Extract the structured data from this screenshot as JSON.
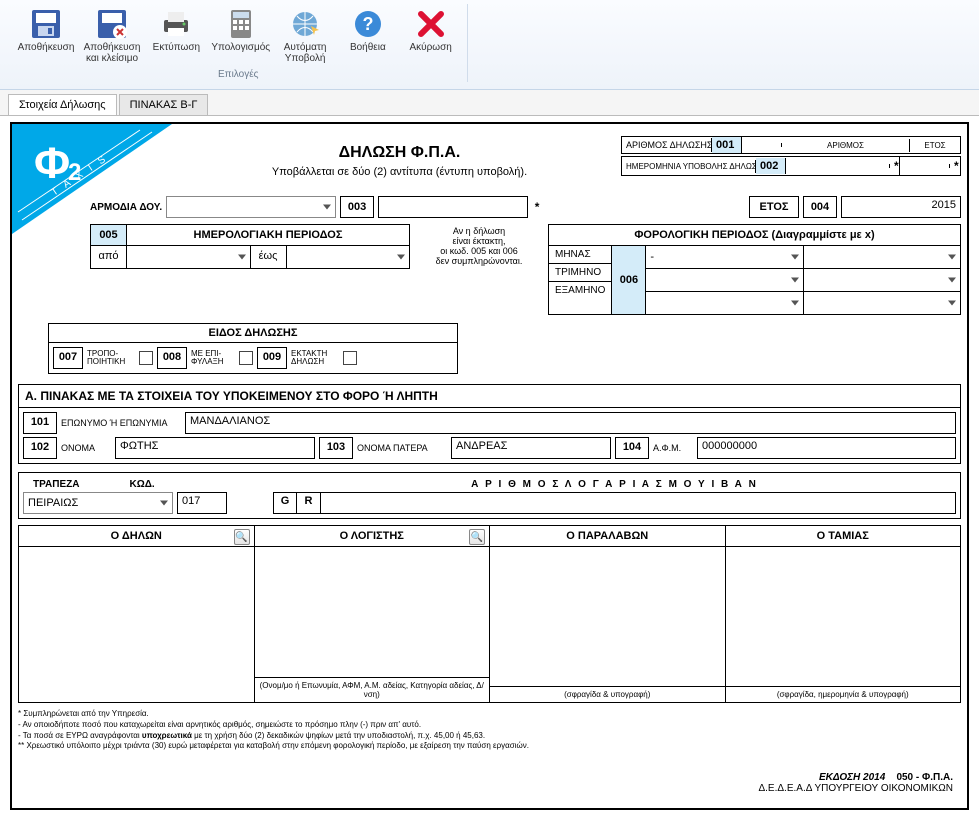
{
  "ribbon": {
    "save": "Αποθήκευση",
    "saveclose1": "Αποθήκευση",
    "saveclose2": "και κλείσιμο",
    "print": "Εκτύπωση",
    "calc": "Υπολογισμός",
    "autosubmit1": "Αυτόματη",
    "autosubmit2": "Υποβολή",
    "help": "Βοήθεια",
    "cancel": "Ακύρωση",
    "group": "Επιλογές"
  },
  "tabs": {
    "t1": "Στοιχεία Δήλωσης",
    "t2": "ΠΙΝΑΚΑΣ Β-Γ"
  },
  "title": {
    "h": "ΔΗΛΩΣΗ Φ.Π.Α.",
    "sub": "Υποβάλλεται σε δύο (2) αντίτυπα (έντυπη υποβολή)."
  },
  "hdr": {
    "arith_dil": "ΑΡΙΘΜΟΣ ΔΗΛΩΣΗΣ",
    "c001": "001",
    "arithmos": "ΑΡΙΘΜΟΣ",
    "etos": "ΕΤΟΣ",
    "imer": "ΗΜΕΡΟΜΗΝΙΑ ΥΠΟΒΟΛΗΣ ΔΗΛΩΣΗΣ",
    "c002": "002"
  },
  "doy": {
    "lbl": "ΑΡΜΟΔΙΑ ΔΟΥ.",
    "c003": "003",
    "etos_lbl": "ΕΤΟΣ",
    "c004": "004",
    "year": "2015"
  },
  "period": {
    "c005": "005",
    "hmer": "ΗΜΕΡΟΛΟΓΙΑΚΗ ΠΕΡΙΟΔΟΣ",
    "apo": "από",
    "eos": "έως",
    "note1": "Αν η δήλωση",
    "note2": "είναι έκτακτη,",
    "note3": "οι κωδ. 005 και 006",
    "note4": "δεν συμπληρώνονται.",
    "forper": "ΦΟΡΟΛΟΓΙΚΗ ΠΕΡΙΟΔΟΣ (Διαγραμμίστε με x)",
    "minas": "ΜΗΝΑΣ",
    "trimino": "ΤΡΙΜΗΝΟ",
    "examino": "ΕΞΑΜΗΝΟ",
    "c006": "006",
    "sel": "-"
  },
  "eidos": {
    "title": "ΕΙΔΟΣ  ΔΗΛΩΣΗΣ",
    "c007": "007",
    "tropo": "ΤΡΟΠΟ-\nΠΟΙΗΤΙΚΗ",
    "c008": "008",
    "epif": "ΜΕ ΕΠΙ-\nΦΥΛΑΞΗ",
    "c009": "009",
    "ektakti": "ΕΚΤΑΚΤΗ\nΔΗΛΩΣΗ"
  },
  "pinA": {
    "title": "Α. ΠΙΝΑΚΑΣ ΜΕ ΤΑ ΣΤΟΙΧΕΙΑ ΤΟΥ ΥΠΟΚΕΙΜΕΝΟΥ ΣΤΟ ΦΟΡΟ Ή ΛΗΠΤΗ",
    "c101": "101",
    "eponymo_l": "ΕΠΩΝΥΜΟ Ή ΕΠΩΝΥΜΙΑ",
    "eponymo_v": "ΜΑΝΔΑΛΙΑΝΟΣ",
    "c102": "102",
    "onoma_l": "ΟΝΟΜΑ",
    "onoma_v": "ΦΩΤΗΣ",
    "c103": "103",
    "patros_l": "ΟΝΟΜΑ ΠΑΤΕΡΑ",
    "patros_v": "ΑΝΔΡΕΑΣ",
    "c104": "104",
    "afm_l": "Α.Φ.Μ.",
    "afm_v": "000000000"
  },
  "bank": {
    "trapeza": "ΤΡΑΠΕΖΑ",
    "kod": "ΚΩΔ.",
    "sel": "ΠΕΙΡΑΙΩΣ",
    "kodv": "017",
    "iban_title": "Α Ρ Ι Θ Μ Ο Σ   Λ Ο Γ Α Ρ Ι Α Σ Μ Ο Υ   Ι Β Α Ν",
    "g": "G",
    "r": "R"
  },
  "sig": {
    "dilon": "Ο ΔΗΛΩΝ",
    "logistis": "Ο ΛΟΓΙΣΤΗΣ",
    "paralavon": "Ο ΠΑΡΑΛΑΒΩΝ",
    "tamias": "Ο ΤΑΜΙΑΣ",
    "f2": "(Ονομ/μο ή Επωνυμία, ΑΦΜ, Α.Μ. αδείας, Κατηγορία αδείας, Δ/νση)",
    "f3": "(σφραγίδα & υπογραφή)",
    "f4": "(σφραγίδα, ημερομηνία & υπογραφή)"
  },
  "notes": {
    "star": "* Συμπληρώνεται από την Υπηρεσία.",
    "n1": "- Αν οποιοδήποτε ποσό που καταχωρείται είναι αρνητικός αριθμός, σημειώστε το πρόσημο πλην (-) πριν απ' αυτό.",
    "n2": "- Τα ποσά σε ΕΥΡΩ αναγράφονται <b>υποχρεωτικά</b> με τη χρήση δύο (2) δεκαδικών ψηφίων μετά την υποδιαστολή, π.χ. 45,00 ή 45,63.",
    "n3": "** Χρεωστικό υπόλοιπο μέχρι τριάντα (30) ευρώ μεταφέρεται για καταβολή στην επόμενη φορολογική περίοδο, με εξαίρεση την παύση εργασιών."
  },
  "footer": {
    "ekdosi": "ΕΚΔΟΣΗ  2014",
    "code": "050 - Φ.Π.Α.",
    "org": "Δ.Ε.Δ.Ε.Α.Δ ΥΠΟΥΡΓΕΙΟΥ ΟΙΚΟΝΟΜΙΚΩΝ"
  },
  "badge": {
    "f": "Φ",
    "two": "2",
    "taxis": "T A X I S"
  }
}
